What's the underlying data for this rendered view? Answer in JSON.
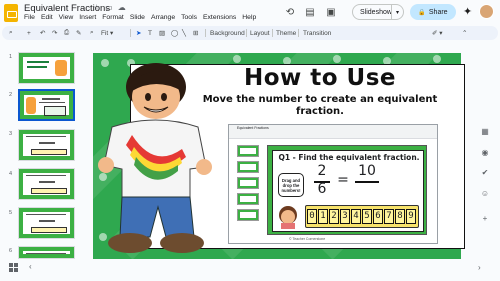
{
  "app": {
    "doc_title": "Equivalent Fractions",
    "menu": [
      "File",
      "Edit",
      "View",
      "Insert",
      "Format",
      "Slide",
      "Arrange",
      "Tools",
      "Extensions",
      "Help"
    ]
  },
  "header": {
    "slideshow_label": "Slideshow",
    "share_label": "Share"
  },
  "toolbar": {
    "zoom_label": "Fit",
    "background_label": "Background",
    "layout_label": "Layout",
    "theme_label": "Theme",
    "transition_label": "Transition"
  },
  "filmstrip": {
    "slides": [
      {
        "number": "1",
        "title": "Equivalent Fractions"
      },
      {
        "number": "2",
        "title": "How to Use"
      },
      {
        "number": "3",
        "title": "Find the equivalent fraction."
      },
      {
        "number": "4",
        "title": "Find the equivalent fraction."
      },
      {
        "number": "5",
        "title": "Find the equivalent fraction."
      },
      {
        "number": "6",
        "title": "Find the equivalent fraction."
      }
    ]
  },
  "slide": {
    "heading": "How to Use",
    "subheading": "Move the number to create an equivalent fraction.",
    "inner": {
      "doc_title": "Equivalent Fractions",
      "question": "Q1 - Find the equivalent fraction.",
      "left_num": "2",
      "left_den": "6",
      "equals": "=",
      "right_num": "10",
      "drag_hint": "Drag and drop the numbers!",
      "digits": [
        "0",
        "1",
        "2",
        "3",
        "4",
        "5",
        "6",
        "7",
        "8",
        "9"
      ],
      "footer": "© Teacher Cornerstone"
    }
  },
  "colors": {
    "slide_green": "#2fa84f",
    "accent_blue": "#0b57d0",
    "share_bg": "#c2e7ff",
    "number_tile": "#fff59d"
  }
}
